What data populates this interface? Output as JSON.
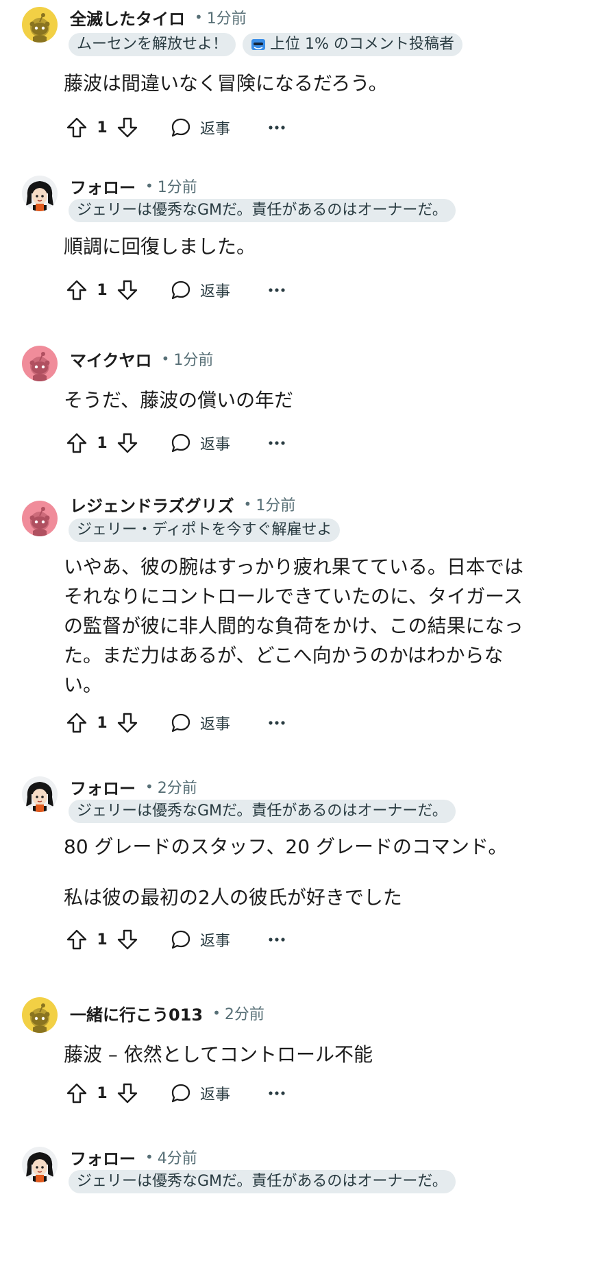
{
  "actions": {
    "reply_label": "返事"
  },
  "comments": [
    {
      "username": "全滅したタイロ",
      "time": "1分前",
      "avatar": "snoo-yellow",
      "flairs": [
        "ムーセンを解放せよ！",
        "上位 1% のコメント投稿者"
      ],
      "body": "藤波は間違いなく冒険になるだろう。",
      "votes": "1"
    },
    {
      "username": "フォロー",
      "time": "1分前",
      "avatar": "anime-character",
      "flairs": [
        "ジェリーは優秀なGMだ。責任があるのはオーナーだ。"
      ],
      "body": "順調に回復しました。",
      "votes": "1"
    },
    {
      "username": "マイクヤロ",
      "time": "1分前",
      "avatar": "snoo-pink",
      "flairs": [],
      "body": "そうだ、藤波の償いの年だ",
      "votes": "1"
    },
    {
      "username": "レジェンドラズグリズ",
      "time": "1分前",
      "avatar": "snoo-pink",
      "flairs": [
        "ジェリー・ディポトを今すぐ解雇せよ"
      ],
      "body": "いやあ、彼の腕はすっかり疲れ果てている。日本では\nそれなりにコントロールできていたのに、タイガース\nの監督が彼に非人間的な負荷をかけ、この結果になっ\nた。まだ力はあるが、どこへ向かうのかはわからな\nい。",
      "votes": "1"
    },
    {
      "username": "フォロー",
      "time": "2分前",
      "avatar": "anime-character",
      "flairs": [
        "ジェリーは優秀なGMだ。責任があるのはオーナーだ。"
      ],
      "body": "80 グレードのスタッフ、20 グレードのコマンド。\n\n私は彼の最初の2人の彼氏が好きでした",
      "votes": "1"
    },
    {
      "username": "一緒に行こう013",
      "time": "2分前",
      "avatar": "snoo-yellow",
      "flairs": [],
      "body": "藤波 – 依然としてコントロール不能",
      "votes": "1"
    },
    {
      "username": "フォロー",
      "time": "4分前",
      "avatar": "anime-character",
      "flairs": [
        "ジェリーは優秀なGMだ。責任があるのはオーナーだ。"
      ],
      "body": "",
      "votes": ""
    }
  ]
}
